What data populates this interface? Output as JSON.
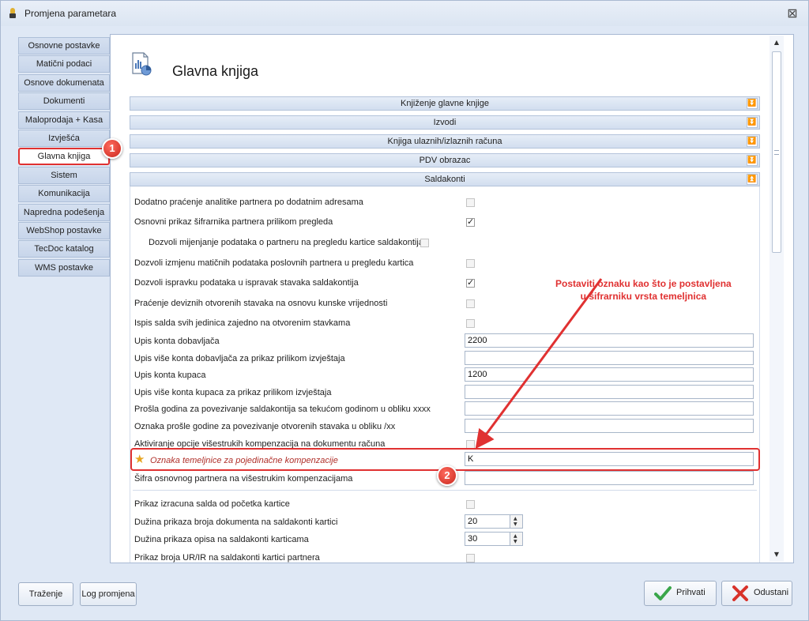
{
  "window": {
    "title": "Promjena parametara",
    "close_glyph": "⊠"
  },
  "sidebar": {
    "items": [
      {
        "label": "Osnovne postavke"
      },
      {
        "label": "Matični podaci"
      },
      {
        "label": "Osnove dokumenata"
      },
      {
        "label": "Dokumenti"
      },
      {
        "label": "Maloprodaja + Kasa"
      },
      {
        "label": "Izvješća"
      },
      {
        "label": "Glavna knjiga"
      },
      {
        "label": "Sistem"
      },
      {
        "label": "Komunikacija"
      },
      {
        "label": "Napredna podešenja"
      },
      {
        "label": "WebShop postavke"
      },
      {
        "label": "TecDoc katalog"
      },
      {
        "label": "WMS postavke"
      }
    ],
    "active_index": 6
  },
  "badges": {
    "one": "1",
    "two": "2"
  },
  "main": {
    "title": "Glavna knjiga",
    "groups": [
      {
        "label": "Knjiženje glavne knjige",
        "expanded": false
      },
      {
        "label": "Izvodi",
        "expanded": false
      },
      {
        "label": "Knjiga ulaznih/izlaznih računa",
        "expanded": false
      },
      {
        "label": "PDV obrazac",
        "expanded": false
      },
      {
        "label": "Saldakonti",
        "expanded": true
      }
    ],
    "chevron_down": "⏬",
    "chevron_up": "⏫",
    "saldakonti": {
      "rows": [
        {
          "label": "Dodatno praćenje analitike partnera po dodatnim adresama",
          "type": "checkbox",
          "checked": false
        },
        {
          "label": "Osnovni prikaz šifrarnika partnera prilikom pregleda",
          "type": "checkbox",
          "checked": true
        },
        {
          "label": "Dozvoli mijenjanje podataka o partneru na pregledu kartice saldakontija",
          "type": "checkbox",
          "checked": false
        },
        {
          "label": "Dozvoli izmjenu matičnih podataka poslovnih partnera u pregledu kartica",
          "type": "checkbox",
          "checked": false
        },
        {
          "label": "Dozvoli ispravku podataka u ispravak stavaka saldakontija",
          "type": "checkbox",
          "checked": true
        },
        {
          "label": "Praćenje deviznih otvorenih stavaka na osnovu kunske vrijednosti",
          "type": "checkbox",
          "checked": false
        },
        {
          "label": "Ispis salda svih jedinica zajedno na otvorenim stavkama",
          "type": "checkbox",
          "checked": false
        },
        {
          "label": "Upis konta dobavljača",
          "type": "text",
          "value": "2200"
        },
        {
          "label": "Upis više konta dobavljača za prikaz prilikom izvještaja",
          "type": "text",
          "value": ""
        },
        {
          "label": "Upis konta kupaca",
          "type": "text",
          "value": "1200"
        },
        {
          "label": "Upis više konta kupaca za prikaz prilikom izvještaja",
          "type": "text",
          "value": ""
        },
        {
          "label": "Prošla godina za povezivanje saldakontija sa tekućom godinom u obliku xxxx",
          "type": "text",
          "value": ""
        },
        {
          "label": "Oznaka prošle godine za povezivanje otvorenih stavaka u obliku /xx",
          "type": "text",
          "value": ""
        },
        {
          "label": "Aktiviranje opcije višestrukih kompenzacija na dokumentu računa",
          "type": "checkbox",
          "checked": false
        },
        {
          "label": "Oznaka temeljnice za pojedinačne kompenzacije",
          "type": "text",
          "value": "K"
        },
        {
          "label": "Šifra osnovnog partnera na višestrukim kompenzacijama",
          "type": "text",
          "value": ""
        },
        {
          "label": "Prikaz izracuna salda od početka kartice",
          "type": "checkbox",
          "checked": false
        },
        {
          "label": "Dužina prikaza broja dokumenta na saldakonti kartici",
          "type": "spin",
          "value": "20"
        },
        {
          "label": "Dužina prikaza opisa na saldakonti karticama",
          "type": "spin",
          "value": "30"
        },
        {
          "label": "Prikaz broja UR/IR na saldakonti kartici partnera",
          "type": "checkbox",
          "checked": false
        }
      ]
    }
  },
  "annotation": {
    "line1": "Postaviti oznaku kao što je postavljena",
    "line2": "u šifrarniku vrsta temeljnica",
    "color": "#e03131"
  },
  "footer": {
    "search_label": "Traženje",
    "log_label": "Log promjena",
    "accept_label": "Prihvati",
    "cancel_label": "Odustani"
  },
  "icons": {
    "app": "lamp-icon",
    "doc": "report-document-icon",
    "star": "star-icon",
    "accept": "checkmark-icon",
    "cancel": "cross-icon"
  },
  "colors": {
    "highlight": "#e03131",
    "accept": "#3aa64a",
    "cancel": "#d8322a"
  }
}
